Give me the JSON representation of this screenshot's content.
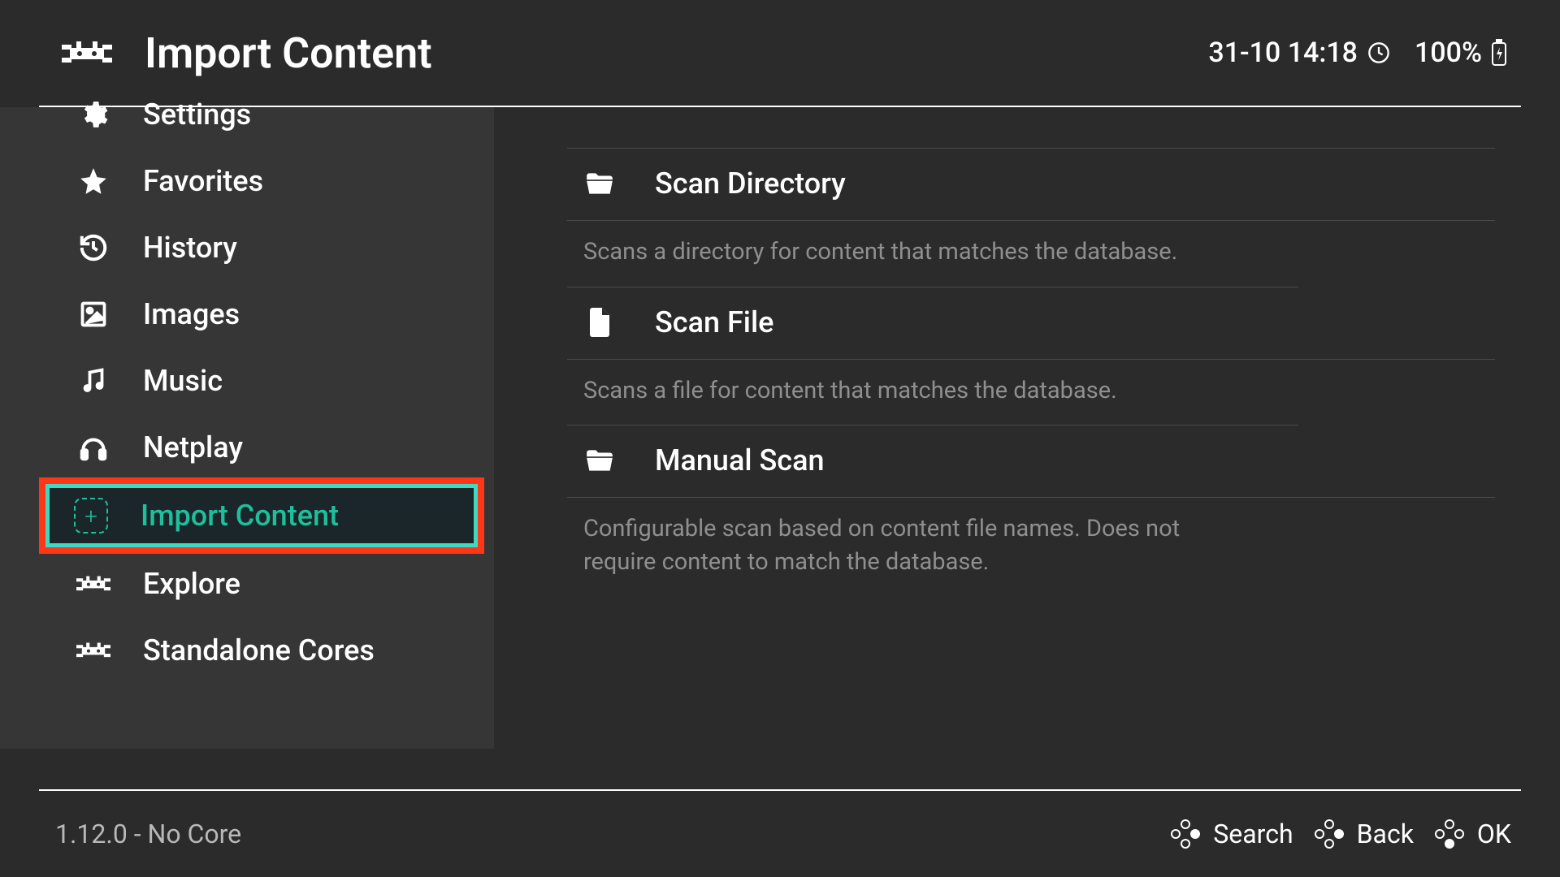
{
  "header": {
    "title": "Import Content",
    "datetime": "31-10 14:18",
    "battery": "100%"
  },
  "sidebar": {
    "items": [
      {
        "label": "Settings"
      },
      {
        "label": "Favorites"
      },
      {
        "label": "History"
      },
      {
        "label": "Images"
      },
      {
        "label": "Music"
      },
      {
        "label": "Netplay"
      },
      {
        "label": "Import Content"
      },
      {
        "label": "Explore"
      },
      {
        "label": "Standalone Cores"
      }
    ]
  },
  "content": {
    "items": [
      {
        "title": "Scan Directory",
        "description": "Scans a directory for content that matches the database."
      },
      {
        "title": "Scan File",
        "description": "Scans a file for content that matches the database."
      },
      {
        "title": "Manual Scan",
        "description": "Configurable scan based on content file names. Does not require content to match the database."
      }
    ]
  },
  "footer": {
    "version": "1.12.0 - No Core",
    "search": "Search",
    "back": "Back",
    "ok": "OK"
  }
}
